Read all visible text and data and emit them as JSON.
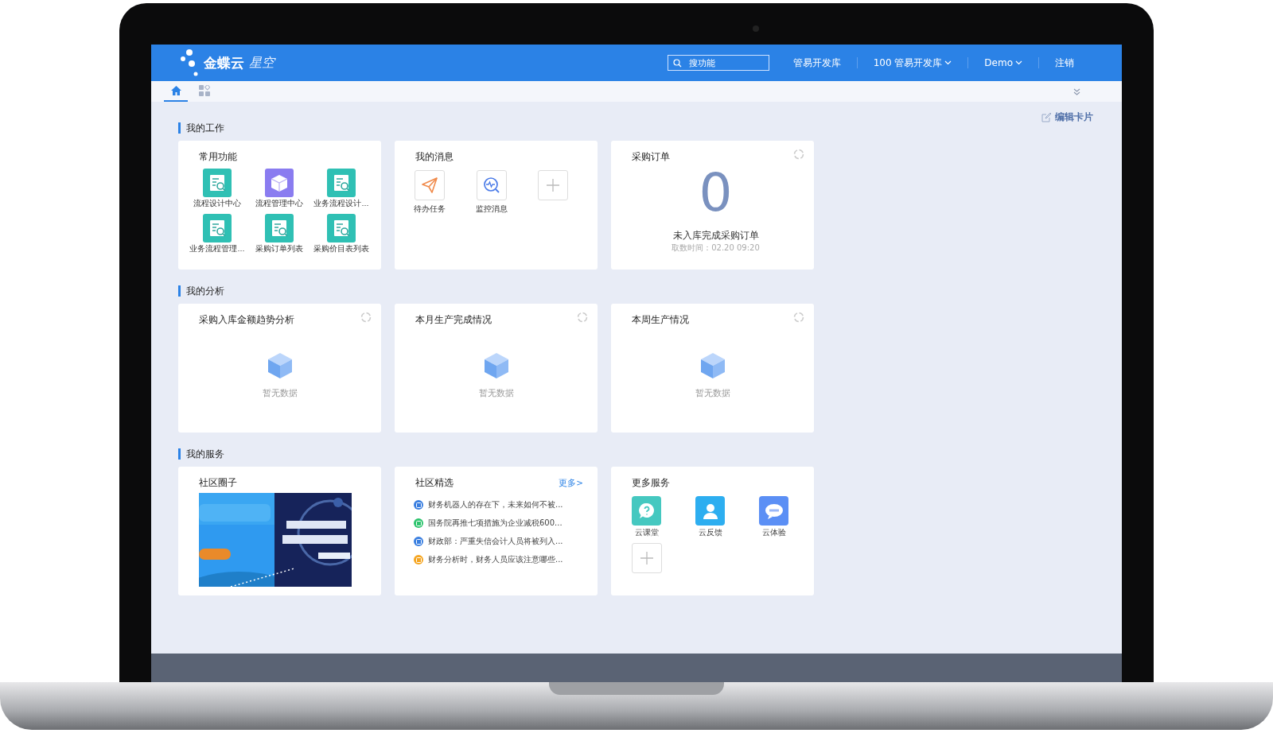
{
  "header": {
    "logo_text": "金蝶云",
    "logo_sub": "星空",
    "search": {
      "placeholder": "搜功能"
    },
    "nav": [
      {
        "label": "管易开发库",
        "dropdown": false
      },
      {
        "label": "100 管易开发库",
        "dropdown": true
      },
      {
        "label": "Demo",
        "dropdown": true
      },
      {
        "label": "注销",
        "dropdown": false
      }
    ]
  },
  "tabs": [
    {
      "kind": "home",
      "selected": true
    },
    {
      "kind": "apps",
      "selected": false
    }
  ],
  "edit_cards": "编辑卡片",
  "sections": [
    {
      "title": "我的工作",
      "cards": [
        {
          "kind": "apps",
          "title": "常用功能",
          "items": [
            {
              "label": "流程设计中心",
              "color": "#2fc0b4"
            },
            {
              "label": "流程管理中心",
              "color": "#8a7cf0"
            },
            {
              "label": "业务流程设计...",
              "color": "#2fc0b4"
            },
            {
              "label": "业务流程管理...",
              "color": "#2fc0b4"
            },
            {
              "label": "采购订单列表",
              "color": "#2fc0b4"
            },
            {
              "label": "采购价目表列表",
              "color": "#2fc0b4"
            }
          ]
        },
        {
          "kind": "messages",
          "title": "我的消息",
          "items": [
            {
              "label": "待办任务"
            },
            {
              "label": "监控消息"
            }
          ],
          "add": true
        },
        {
          "kind": "number",
          "title": "采购订单",
          "value": "0",
          "caption": "未入库完成采购订单",
          "time": "取数时间：02.20 09:20"
        }
      ]
    },
    {
      "title": "我的分析",
      "cards": [
        {
          "kind": "empty",
          "title": "采购入库金额趋势分析",
          "empty_text": "暂无数据"
        },
        {
          "kind": "empty",
          "title": "本月生产完成情况",
          "empty_text": "暂无数据"
        },
        {
          "kind": "empty",
          "title": "本周生产情况",
          "empty_text": "暂无数据"
        }
      ]
    },
    {
      "title": "我的服务",
      "cards": [
        {
          "kind": "banner",
          "title": "社区圈子"
        },
        {
          "kind": "news",
          "title": "社区精选",
          "more": "更多>",
          "items": [
            {
              "text": "财务机器人的存在下，未来如何不被...",
              "color": "#3a7fe0"
            },
            {
              "text": "国务院再推七项措施为企业减税600...",
              "color": "#2ec46e"
            },
            {
              "text": "财政部：严重失信会计人员将被列入...",
              "color": "#3a7fe0"
            },
            {
              "text": "财务分析时，财务人员应该注意哪些...",
              "color": "#f5a623"
            }
          ]
        },
        {
          "kind": "services",
          "title": "更多服务",
          "items": [
            {
              "label": "云课堂",
              "color": "#45c8c0"
            },
            {
              "label": "云反馈",
              "color": "#2daef0"
            },
            {
              "label": "云体验",
              "color": "#5b8ff5"
            }
          ],
          "add": true
        }
      ]
    }
  ]
}
